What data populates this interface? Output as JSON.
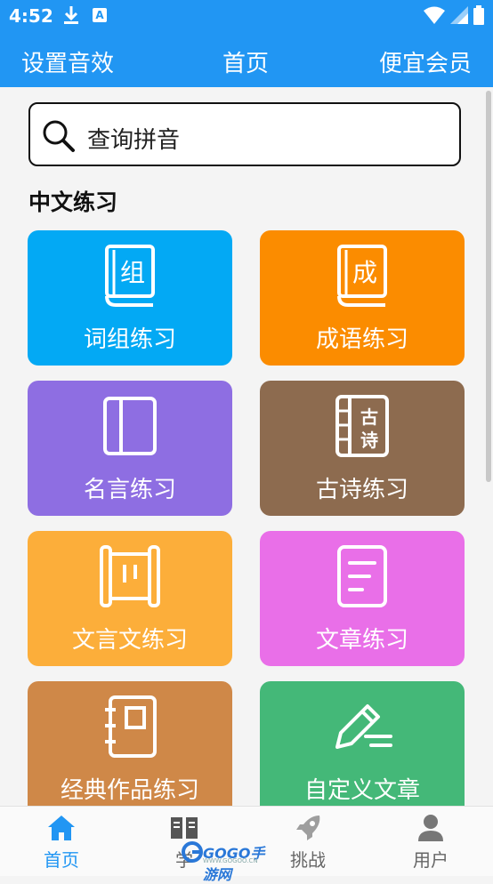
{
  "status": {
    "time": "4:52",
    "a_badge": "A"
  },
  "header": {
    "left": "设置音效",
    "title": "首页",
    "right": "便宜会员"
  },
  "search": {
    "placeholder": "查询拼音"
  },
  "section": {
    "title": "中文练习"
  },
  "cards": [
    {
      "label": "词组练习",
      "color": "#03a9f4",
      "icon": "book-zu-icon",
      "glyph": "组"
    },
    {
      "label": "成语练习",
      "color": "#fb8c00",
      "icon": "book-cheng-icon",
      "glyph": "成"
    },
    {
      "label": "名言练习",
      "color": "#8e6ee2",
      "icon": "open-book-icon"
    },
    {
      "label": "古诗练习",
      "color": "#8d6b4f",
      "icon": "poem-book-icon",
      "glyph1": "古",
      "glyph2": "诗"
    },
    {
      "label": "文言文练习",
      "color": "#fcae3a",
      "icon": "scroll-icon"
    },
    {
      "label": "文章练习",
      "color": "#e96fe8",
      "icon": "document-icon"
    },
    {
      "label": "经典作品练习",
      "color": "#cf8848",
      "icon": "notebook-icon"
    },
    {
      "label": "自定义文章",
      "color": "#44b878",
      "icon": "pencil-icon"
    }
  ],
  "nav": [
    {
      "label": "首页",
      "icon": "home-icon"
    },
    {
      "label": "学",
      "icon": "study-book-icon"
    },
    {
      "label": "挑战",
      "icon": "rocket-icon"
    },
    {
      "label": "用户",
      "icon": "user-icon"
    }
  ],
  "watermark": {
    "text": "GOGO手游网",
    "sub": "WWW.GOGOO.CN"
  }
}
